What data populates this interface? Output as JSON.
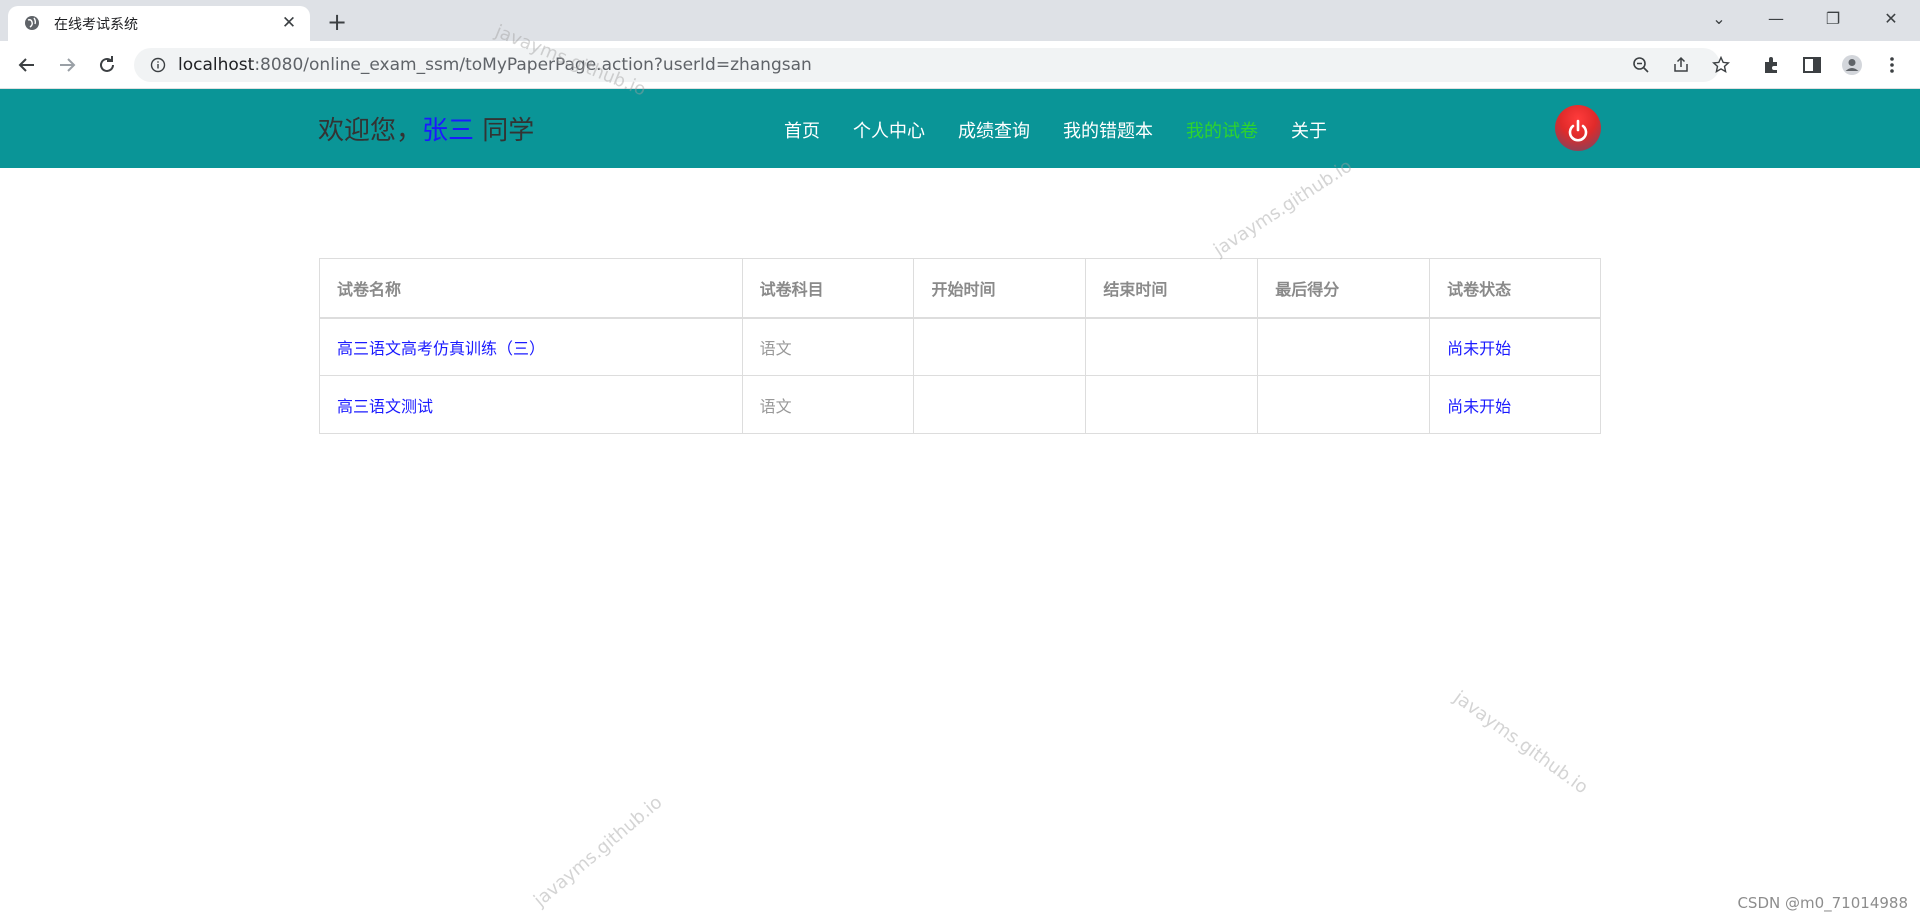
{
  "browser": {
    "tab_title": "在线考试系统",
    "new_tab_glyph": "+",
    "close_glyph": "✕",
    "url_host": "localhost",
    "url_rest": ":8080/online_exam_ssm/toMyPaperPage.action?userId=zhangsan",
    "window_controls": [
      "⌄",
      "—",
      "❐",
      "✕"
    ]
  },
  "header": {
    "welcome_prefix": "欢迎您，",
    "username": "张三",
    "welcome_suffix": " 同学",
    "nav": [
      {
        "label": "首页",
        "active": false
      },
      {
        "label": "个人中心",
        "active": false
      },
      {
        "label": "成绩查询",
        "active": false
      },
      {
        "label": "我的错题本",
        "active": false
      },
      {
        "label": "我的试卷",
        "active": true
      },
      {
        "label": "关于",
        "active": false
      }
    ],
    "accent_color": "#0a9597",
    "active_color": "#2dd42d"
  },
  "table": {
    "columns": [
      "试卷名称",
      "试卷科目",
      "开始时间",
      "结束时间",
      "最后得分",
      "试卷状态"
    ],
    "rows": [
      {
        "name": "高三语文高考仿真训练（三）",
        "subject": "语文",
        "start": "",
        "end": "",
        "score": "",
        "status": "尚未开始"
      },
      {
        "name": "高三语文测试",
        "subject": "语文",
        "start": "",
        "end": "",
        "score": "",
        "status": "尚未开始"
      }
    ]
  },
  "watermark_text": "javayms.github.io",
  "footer_credit": "CSDN @m0_71014988"
}
